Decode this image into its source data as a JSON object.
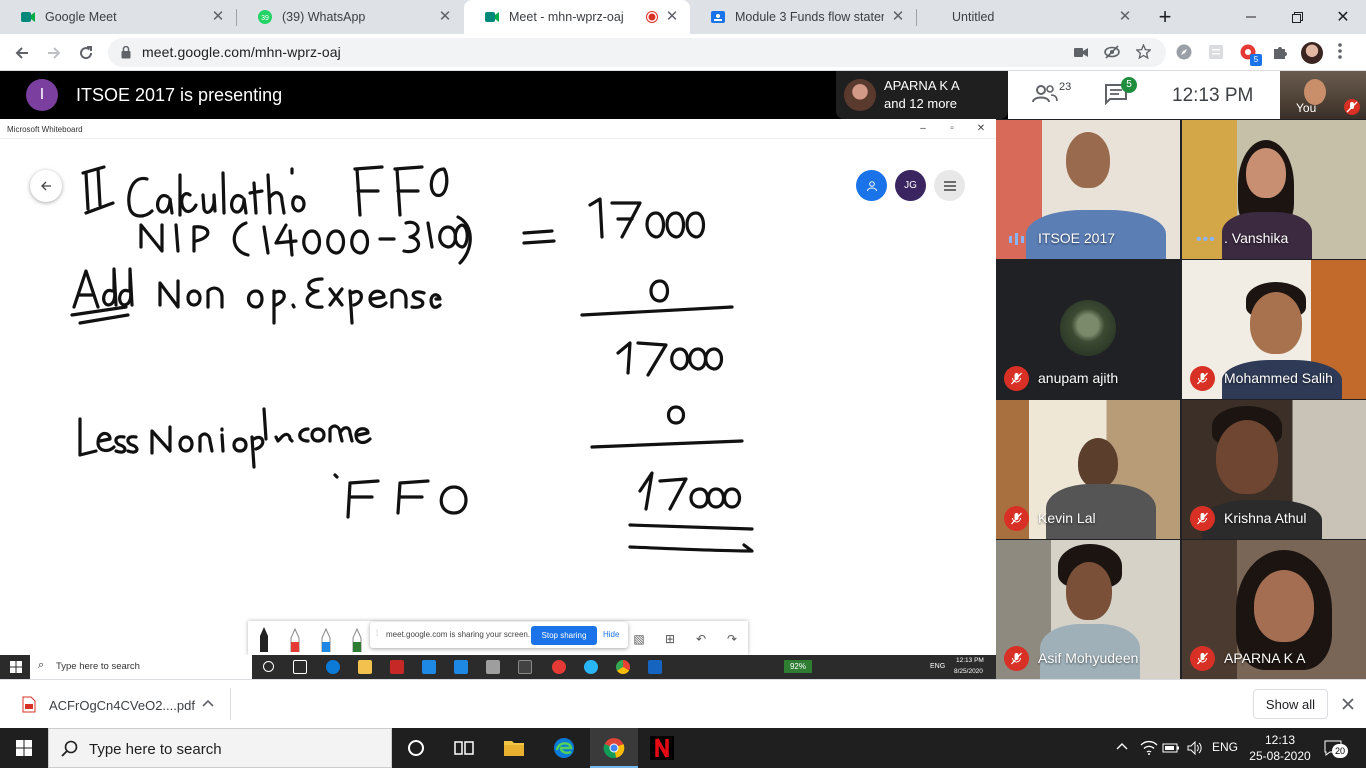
{
  "browser": {
    "tabs": [
      {
        "title": "Google Meet",
        "active": false
      },
      {
        "title": "(39) WhatsApp",
        "active": false
      },
      {
        "title": "Meet - mhn-wprz-oaj",
        "active": true
      },
      {
        "title": "Module 3 Funds flow statemen",
        "active": false
      },
      {
        "title": "Untitled",
        "active": false
      }
    ],
    "url": "meet.google.com/mhn-wprz-oaj",
    "extension_badge": "5"
  },
  "meet": {
    "presenter_initial": "I",
    "presenting_text": "ITSOE 2017 is presenting",
    "people_chip": {
      "line1": "APARNA K A",
      "line2": "and 12 more"
    },
    "participant_count": "23",
    "chat_badge": "5",
    "clock": "12:13  PM",
    "self_label": "You"
  },
  "whiteboard": {
    "window_title": "Microsoft Whiteboard",
    "avatar_initials": "JG",
    "share_text": "meet.google.com is sharing your screen.",
    "stop_sharing": "Stop sharing",
    "hide": "Hide"
  },
  "inner_taskbar": {
    "search_placeholder": "Type here to search",
    "battery": "92%",
    "lang": "ENG",
    "time": "12:13 PM",
    "date": "8/25/2020"
  },
  "participants": [
    {
      "name": "ITSOE 2017",
      "muted": false,
      "speaking": true
    },
    {
      "name": ". Vanshika",
      "muted": false,
      "speaking": false
    },
    {
      "name": "anupam ajith",
      "muted": true
    },
    {
      "name": "Mohammed Salih",
      "muted": true
    },
    {
      "name": "Kevin Lal",
      "muted": true
    },
    {
      "name": "Krishna Athul",
      "muted": true
    },
    {
      "name": "Asif Mohyudeen",
      "muted": true
    },
    {
      "name": "APARNA K A",
      "muted": true
    }
  ],
  "downloads": {
    "file": "ACFrOgCn4CVeO2....pdf",
    "show_all": "Show all"
  },
  "taskbar": {
    "search_placeholder": "Type here to search",
    "lang": "ENG",
    "time": "12:13",
    "date": "25-08-2020",
    "notifications": "20"
  }
}
